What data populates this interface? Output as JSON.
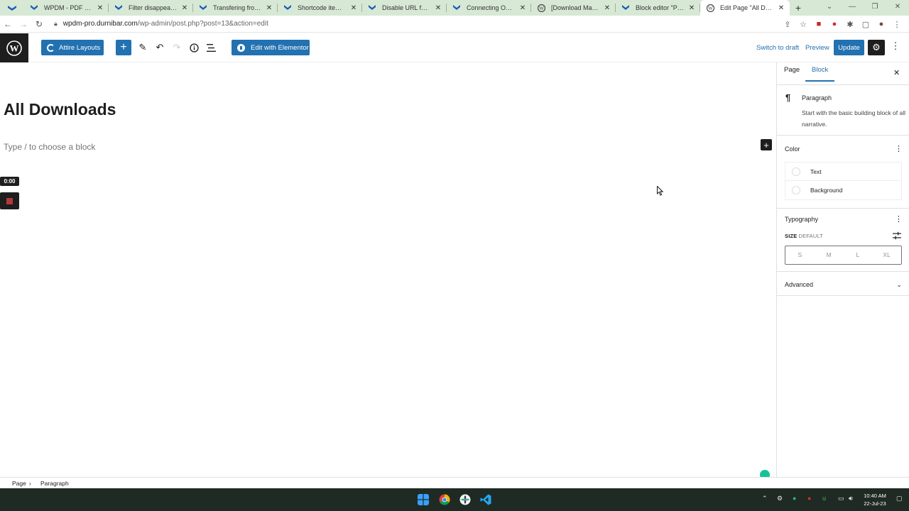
{
  "browser": {
    "tabs": [
      {
        "title": "WPDM - PDF Viewer",
        "favicon": "wpdm-icon"
      },
      {
        "title": "Filter disappearing aft",
        "favicon": "wpdm-icon"
      },
      {
        "title": "Transfering from local",
        "favicon": "wpdm-icon"
      },
      {
        "title": "Shortcode items per",
        "favicon": "wpdm-icon"
      },
      {
        "title": "Disable URL for down",
        "favicon": "wpdm-icon"
      },
      {
        "title": "Connecting One Drive",
        "favicon": "wpdm-icon"
      },
      {
        "title": "[Download Manager]",
        "favicon": "wordpress-icon"
      },
      {
        "title": "Block editor \"Package",
        "favicon": "wpdm-icon"
      },
      {
        "title": "Edit Page \"All Downlo",
        "favicon": "wordpress-icon",
        "active": true
      }
    ],
    "url_host": "wpdm-pro.durnibar.com",
    "url_path": "/wp-admin/post.php?post=13&action=edit",
    "tab_bar_color": "#d7e8d5"
  },
  "toolbar": {
    "attire_label": "Attire Layouts",
    "elementor_label": "Edit with Elementor",
    "switch_draft_label": "Switch to draft",
    "preview_label": "Preview",
    "update_label": "Update",
    "accent": "#2271b1"
  },
  "editor": {
    "title": "All Downloads",
    "block_placeholder": "Type / to choose a block",
    "recorder_time": "0:00"
  },
  "sidebar": {
    "tab_page": "Page",
    "tab_block": "Block",
    "block_name": "Paragraph",
    "block_desc": "Start with the basic building block of all narrative.",
    "color_title": "Color",
    "color_text": "Text",
    "color_background": "Background",
    "typography_title": "Typography",
    "size_label": "SIZE",
    "size_default": "DEFAULT",
    "sizes": [
      "S",
      "M",
      "L",
      "XL"
    ],
    "advanced_title": "Advanced"
  },
  "footer": {
    "crumb_page": "Page",
    "crumb_block": "Paragraph"
  },
  "taskbar": {
    "time": "10:40 AM",
    "date": "22-Jul-23"
  }
}
